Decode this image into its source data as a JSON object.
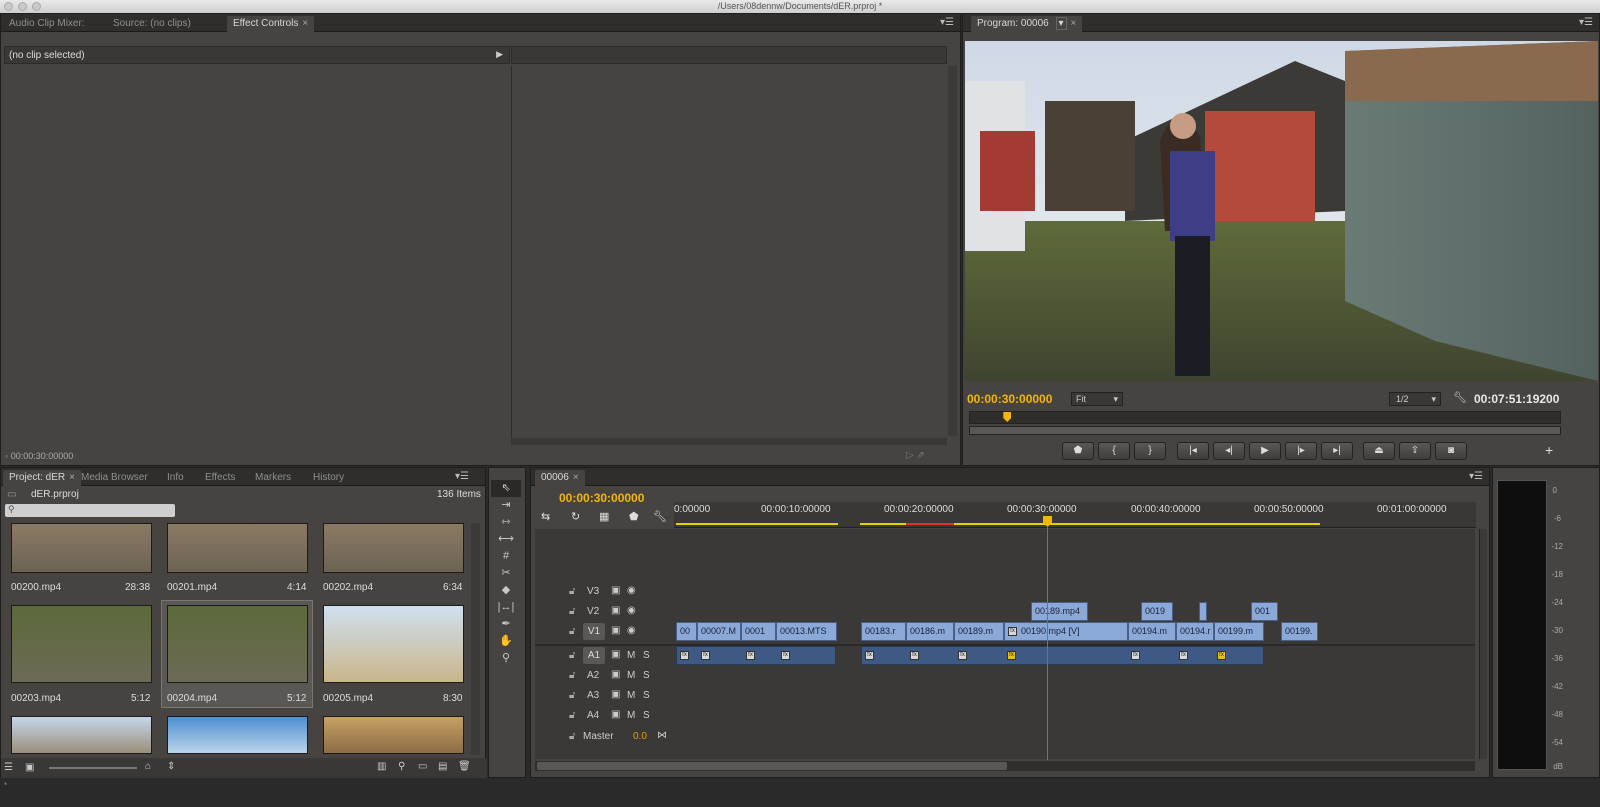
{
  "window": {
    "title": "/Users/08dennw/Documents/dER.prproj *"
  },
  "source_panel": {
    "tabs": [
      "Audio Clip Mixer:",
      "Source: (no clips)",
      "Effect Controls"
    ],
    "active_tab_close": "×",
    "clip_header": "(no clip selected)",
    "timecode": "00:00:30:00000"
  },
  "program_panel": {
    "tab": "Program: 00006",
    "close": "×",
    "timecode_left": "00:00:30:00000",
    "fit_label": "Fit",
    "res_label": "1/2",
    "timecode_right": "00:07:51:19200",
    "playhead_fraction": 0.063
  },
  "project_panel": {
    "tabs": [
      "Project: dER",
      "Media Browser",
      "Info",
      "Effects",
      "Markers",
      "History"
    ],
    "close": "×",
    "project_name": "dER.prproj",
    "item_count": "136 Items",
    "search_placeholder": "",
    "items": [
      {
        "name": "00200.mp4",
        "duration": "28:38"
      },
      {
        "name": "00201.mp4",
        "duration": "4:14"
      },
      {
        "name": "00202.mp4",
        "duration": "6:34"
      },
      {
        "name": "00203.mp4",
        "duration": "5:12"
      },
      {
        "name": "00204.mp4",
        "duration": "5:12"
      },
      {
        "name": "00205.mp4",
        "duration": "8:30"
      }
    ]
  },
  "timeline": {
    "tab": "00006",
    "close": "×",
    "timecode": "00:00:30:00000",
    "ruler": [
      "0:00000",
      "00:00:10:00000",
      "00:00:20:00000",
      "00:00:30:00000",
      "00:00:40:00000",
      "00:00:50:00000",
      "00:01:00:00000"
    ],
    "tracks_video": [
      "V3",
      "V2",
      "V1"
    ],
    "tracks_audio": [
      "A1",
      "A2",
      "A3",
      "A4"
    ],
    "track_m": "M",
    "track_s": "S",
    "master_label": "Master",
    "master_value": "0.0",
    "v2_clips": [
      "00189.mp4",
      "0019",
      "",
      "001"
    ],
    "v1_clips": [
      "00",
      "00007.M",
      "0001",
      "00013.MTS",
      "00183.r",
      "00186.m",
      "00189.m",
      "00190.mp4 [V]",
      "00194.m",
      "00194.r",
      "00199.m",
      "00199."
    ]
  },
  "meter": {
    "labels": [
      "0",
      "-6",
      "-12",
      "-18",
      "-24",
      "-30",
      "-36",
      "-42",
      "-48",
      "-54",
      "dB"
    ]
  },
  "colors": {
    "timecode": "#f2b705",
    "clip_video": "#8aa9d9",
    "clip_audio": "#3e5a84",
    "playhead": "#e0463a"
  }
}
